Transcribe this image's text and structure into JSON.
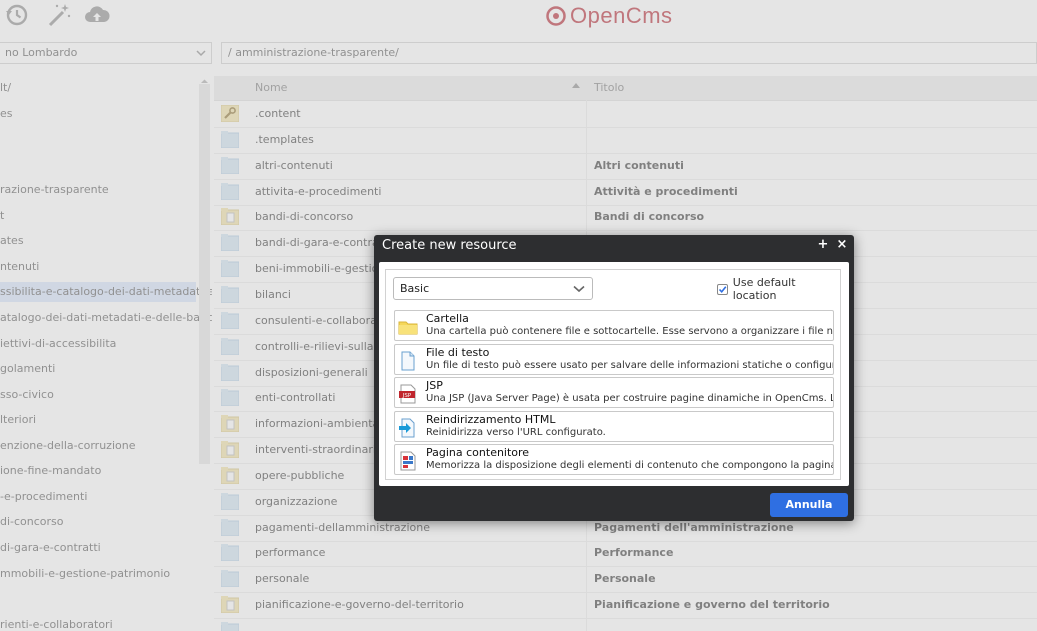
{
  "app": {
    "logo_text": "OpenCms"
  },
  "toolbar": {
    "icons": [
      "history-icon",
      "magic-wand-icon",
      "cloud-upload-icon"
    ]
  },
  "nav": {
    "site_select_value": "no Lombardo",
    "path_value": "/ amministrazione-trasparente/"
  },
  "tree": {
    "items": [
      "lt/",
      "es",
      "",
      "",
      "razione-trasparente",
      "t",
      "ates",
      "ntenuti",
      "ssibilita-e-catalogo-dei-dati-metadati-e",
      "atalogo-dei-dati-metadati-e-delle-banc",
      "iettivi-di-accessibilita",
      "golamenti",
      "sso-civico",
      "lteriori",
      "enzione-della-corruzione",
      "ione-fine-mandato",
      "-e-procedimenti",
      "di-concorso",
      "di-gara-e-contratti",
      "mmobili-e-gestione-patrimonio",
      "",
      "rienti-e-collaboratori"
    ]
  },
  "table": {
    "headers": {
      "name": "Nome",
      "title": "Titolo"
    },
    "rows": [
      {
        "name": ".content",
        "title": "",
        "icon": "wrench-icon"
      },
      {
        "name": ".templates",
        "title": "",
        "icon": "folder-icon"
      },
      {
        "name": "altri-contenuti",
        "title": "Altri contenuti",
        "icon": "folder-icon"
      },
      {
        "name": "attivita-e-procedimenti",
        "title": "Attività e procedimenti",
        "icon": "folder-icon"
      },
      {
        "name": "bandi-di-concorso",
        "title": "Bandi di concorso",
        "icon": "folder-page-icon"
      },
      {
        "name": "bandi-di-gara-e-contratti",
        "title": "",
        "icon": "folder-icon"
      },
      {
        "name": "beni-immobili-e-gestione-patrimonio",
        "title": "",
        "icon": "folder-icon"
      },
      {
        "name": "bilanci",
        "title": "",
        "icon": "folder-icon"
      },
      {
        "name": "consulenti-e-collaboratori",
        "title": "",
        "icon": "folder-icon"
      },
      {
        "name": "controlli-e-rilievi-sullamministrazione",
        "title": "",
        "icon": "folder-icon"
      },
      {
        "name": "disposizioni-generali",
        "title": "",
        "icon": "folder-icon"
      },
      {
        "name": "enti-controllati",
        "title": "",
        "icon": "folder-icon"
      },
      {
        "name": "informazioni-ambientali",
        "title": "",
        "icon": "folder-page-icon"
      },
      {
        "name": "interventi-straordinari-e-di-emergenza",
        "title": "",
        "icon": "folder-page-icon"
      },
      {
        "name": "opere-pubbliche",
        "title": "",
        "icon": "folder-page-icon"
      },
      {
        "name": "organizzazione",
        "title": "",
        "icon": "folder-icon"
      },
      {
        "name": "pagamenti-dellamministrazione",
        "title": "Pagamenti dell'amministrazione",
        "icon": "folder-icon"
      },
      {
        "name": "performance",
        "title": "Performance",
        "icon": "folder-icon"
      },
      {
        "name": "personale",
        "title": "Personale",
        "icon": "folder-icon"
      },
      {
        "name": "pianificazione-e-governo-del-territorio",
        "title": "Pianificazione e governo del territorio",
        "icon": "folder-page-icon"
      },
      {
        "name": "",
        "title": "",
        "icon": "folder-icon"
      }
    ]
  },
  "dialog": {
    "title": "Create new resource",
    "maximize_label": "+",
    "close_label": "×",
    "select_value": "Basic",
    "checkbox_label": "Use default location",
    "checkbox_checked": true,
    "resources": [
      {
        "name": "Cartella",
        "desc": "Una cartella può contenere file e sottocartelle. Esse servono a organizzare i file nel VFS. Le c",
        "icon": "folder-icon"
      },
      {
        "name": "File di testo",
        "desc": "Un file di testo può essere usato per salvare delle informazioni statiche o configurazioni. Ne",
        "icon": "text-file-icon"
      },
      {
        "name": "JSP",
        "desc": "Una JSP (Java Server Page) è usata per costruire pagine dinamiche in OpenCms. L'uso di JSP (",
        "icon": "jsp-file-icon",
        "icon_label": "JSP"
      },
      {
        "name": "Reindirizzamento HTML",
        "desc": "Reinidirizza verso l'URL configurato.",
        "icon": "redirect-icon"
      },
      {
        "name": "Pagina contenitore",
        "desc": "Memorizza la disposizione degli elementi di contenuto che compongono la pagina.",
        "icon": "container-page-icon"
      }
    ],
    "cancel_label": "Annulla"
  },
  "colors": {
    "accent": "#2f6fe2",
    "dialog_bg": "#2d2e30",
    "logo": "#b41f2d",
    "tree_selected": "#d6e3fb"
  }
}
